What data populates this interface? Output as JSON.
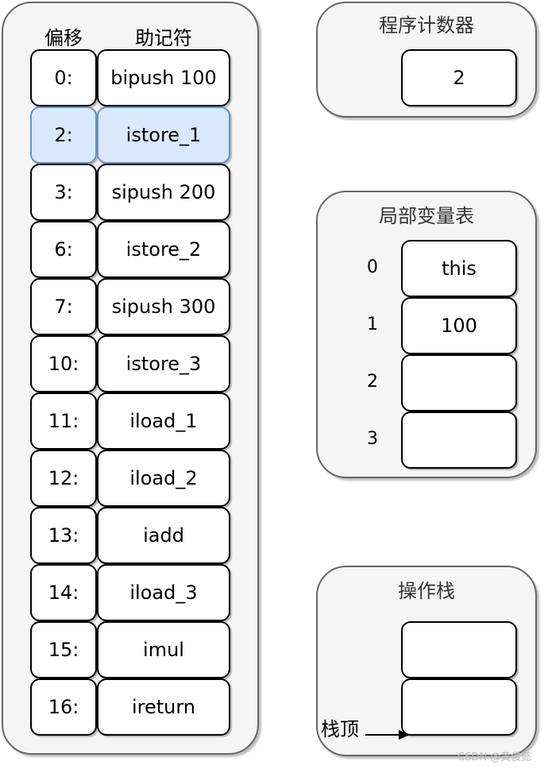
{
  "bytecode": {
    "header_offset": "偏移",
    "header_mnemonic": "助记符",
    "highlight_color": "#dae8fc",
    "rows": [
      {
        "offset": "0:",
        "mnemonic": "bipush 100",
        "highlighted": false
      },
      {
        "offset": "2:",
        "mnemonic": "istore_1",
        "highlighted": true
      },
      {
        "offset": "3:",
        "mnemonic": "sipush 200",
        "highlighted": false
      },
      {
        "offset": "6:",
        "mnemonic": "istore_2",
        "highlighted": false
      },
      {
        "offset": "7:",
        "mnemonic": "sipush 300",
        "highlighted": false
      },
      {
        "offset": "10:",
        "mnemonic": "istore_3",
        "highlighted": false
      },
      {
        "offset": "11:",
        "mnemonic": "iload_1",
        "highlighted": false
      },
      {
        "offset": "12:",
        "mnemonic": "iload_2",
        "highlighted": false
      },
      {
        "offset": "13:",
        "mnemonic": "iadd",
        "highlighted": false
      },
      {
        "offset": "14:",
        "mnemonic": "iload_3",
        "highlighted": false
      },
      {
        "offset": "15:",
        "mnemonic": "imul",
        "highlighted": false
      },
      {
        "offset": "16:",
        "mnemonic": "ireturn",
        "highlighted": false
      }
    ]
  },
  "program_counter": {
    "title": "程序计数器",
    "value": "2"
  },
  "local_variables": {
    "title": "局部变量表",
    "slots": [
      {
        "index": "0",
        "value": "this"
      },
      {
        "index": "1",
        "value": "100"
      },
      {
        "index": "2",
        "value": ""
      },
      {
        "index": "3",
        "value": ""
      }
    ]
  },
  "operand_stack": {
    "title": "操作栈",
    "slots": [
      "",
      ""
    ],
    "top_label": "栈顶"
  },
  "watermark": "CSDN @黄俊懿"
}
